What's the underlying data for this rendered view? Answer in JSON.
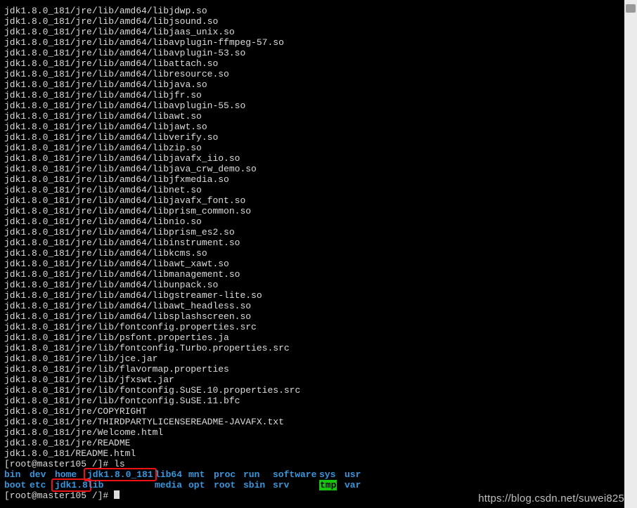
{
  "lines": [
    "jdk1.8.0_181/jre/lib/amd64/libjdwp.so",
    "jdk1.8.0_181/jre/lib/amd64/libjsound.so",
    "jdk1.8.0_181/jre/lib/amd64/libjaas_unix.so",
    "jdk1.8.0_181/jre/lib/amd64/libavplugin-ffmpeg-57.so",
    "jdk1.8.0_181/jre/lib/amd64/libavplugin-53.so",
    "jdk1.8.0_181/jre/lib/amd64/libattach.so",
    "jdk1.8.0_181/jre/lib/amd64/libresource.so",
    "jdk1.8.0_181/jre/lib/amd64/libjava.so",
    "jdk1.8.0_181/jre/lib/amd64/libjfr.so",
    "jdk1.8.0_181/jre/lib/amd64/libavplugin-55.so",
    "jdk1.8.0_181/jre/lib/amd64/libawt.so",
    "jdk1.8.0_181/jre/lib/amd64/libjawt.so",
    "jdk1.8.0_181/jre/lib/amd64/libverify.so",
    "jdk1.8.0_181/jre/lib/amd64/libzip.so",
    "jdk1.8.0_181/jre/lib/amd64/libjavafx_iio.so",
    "jdk1.8.0_181/jre/lib/amd64/libjava_crw_demo.so",
    "jdk1.8.0_181/jre/lib/amd64/libjfxmedia.so",
    "jdk1.8.0_181/jre/lib/amd64/libnet.so",
    "jdk1.8.0_181/jre/lib/amd64/libjavafx_font.so",
    "jdk1.8.0_181/jre/lib/amd64/libprism_common.so",
    "jdk1.8.0_181/jre/lib/amd64/libnio.so",
    "jdk1.8.0_181/jre/lib/amd64/libprism_es2.so",
    "jdk1.8.0_181/jre/lib/amd64/libinstrument.so",
    "jdk1.8.0_181/jre/lib/amd64/libkcms.so",
    "jdk1.8.0_181/jre/lib/amd64/libawt_xawt.so",
    "jdk1.8.0_181/jre/lib/amd64/libmanagement.so",
    "jdk1.8.0_181/jre/lib/amd64/libunpack.so",
    "jdk1.8.0_181/jre/lib/amd64/libgstreamer-lite.so",
    "jdk1.8.0_181/jre/lib/amd64/libawt_headless.so",
    "jdk1.8.0_181/jre/lib/amd64/libsplashscreen.so",
    "jdk1.8.0_181/jre/lib/fontconfig.properties.src",
    "jdk1.8.0_181/jre/lib/psfont.properties.ja",
    "jdk1.8.0_181/jre/lib/fontconfig.Turbo.properties.src",
    "jdk1.8.0_181/jre/lib/jce.jar",
    "jdk1.8.0_181/jre/lib/flavormap.properties",
    "jdk1.8.0_181/jre/lib/jfxswt.jar",
    "jdk1.8.0_181/jre/lib/fontconfig.SuSE.10.properties.src",
    "jdk1.8.0_181/jre/lib/fontconfig.SuSE.11.bfc",
    "jdk1.8.0_181/jre/COPYRIGHT",
    "jdk1.8.0_181/jre/THIRDPARTYLICENSEREADME-JAVAFX.txt",
    "jdk1.8.0_181/jre/Welcome.html",
    "jdk1.8.0_181/jre/README",
    "jdk1.8.0_181/README.html"
  ],
  "prompt1": "[root@master105 /]# ",
  "cmd1": "ls",
  "ls": {
    "row1": [
      {
        "t": "bin",
        "c": "dir",
        "w": 36
      },
      {
        "t": "dev",
        "c": "dir",
        "w": 36
      },
      {
        "t": "home",
        "c": "dir",
        "w": 46
      },
      {
        "t": "jdk1.8.0_181",
        "c": "dir",
        "w": 96,
        "box": true
      },
      {
        "t": "lib64",
        "c": "dir",
        "w": 48
      },
      {
        "t": "mnt",
        "c": "dir",
        "w": 36
      },
      {
        "t": "proc",
        "c": "dir",
        "w": 42
      },
      {
        "t": "run",
        "c": "dir",
        "w": 42
      },
      {
        "t": "software",
        "c": "dir",
        "w": 66
      },
      {
        "t": "sys",
        "c": "dir",
        "w": 36
      },
      {
        "t": "usr",
        "c": "dir",
        "w": 36
      }
    ],
    "row2": [
      {
        "t": "boot",
        "c": "dir",
        "w": 36
      },
      {
        "t": "etc",
        "c": "dir",
        "w": 36
      },
      {
        "t": "jdk1.8",
        "c": "dir",
        "w": 46,
        "box": true
      },
      {
        "t": "lib",
        "c": "dir",
        "w": 96
      },
      {
        "t": "media",
        "c": "dir",
        "w": 48
      },
      {
        "t": "opt",
        "c": "dir",
        "w": 36
      },
      {
        "t": "root",
        "c": "dir",
        "w": 42
      },
      {
        "t": "sbin",
        "c": "dir",
        "w": 42
      },
      {
        "t": "srv",
        "c": "dir",
        "w": 66
      },
      {
        "t": "tmp",
        "c": "tmp",
        "w": 36
      },
      {
        "t": "var",
        "c": "dir",
        "w": 36
      }
    ]
  },
  "prompt2": "[root@master105 /]# ",
  "watermark": "https://blog.csdn.net/suwei825"
}
